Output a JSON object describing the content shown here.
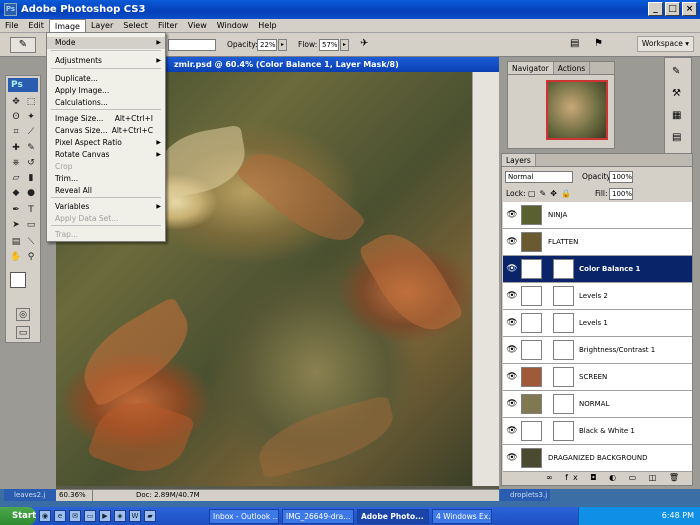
{
  "app": {
    "title": "Adobe Photoshop CS3",
    "icon_label": "Ps"
  },
  "menubar": [
    "File",
    "Edit",
    "Image",
    "Layer",
    "Select",
    "Filter",
    "View",
    "Window",
    "Help"
  ],
  "options": {
    "opacity_label": "Opacity:",
    "opacity_value": "22%",
    "flow_label": "Flow:",
    "flow_value": "57%",
    "workspace_label": "Workspace ▾"
  },
  "image_menu": {
    "items": [
      {
        "label": "Mode",
        "submenu": true,
        "disabled": false,
        "shortcut": ""
      },
      {
        "label": "Adjustments",
        "submenu": true,
        "disabled": false,
        "shortcut": ""
      },
      {
        "label": "Duplicate...",
        "submenu": false,
        "disabled": false,
        "shortcut": ""
      },
      {
        "label": "Apply Image...",
        "submenu": false,
        "disabled": false,
        "shortcut": ""
      },
      {
        "label": "Calculations...",
        "submenu": false,
        "disabled": false,
        "shortcut": ""
      },
      {
        "label": "Image Size...",
        "submenu": false,
        "disabled": false,
        "shortcut": "Alt+Ctrl+I"
      },
      {
        "label": "Canvas Size...",
        "submenu": false,
        "disabled": false,
        "shortcut": "Alt+Ctrl+C"
      },
      {
        "label": "Pixel Aspect Ratio",
        "submenu": true,
        "disabled": false,
        "shortcut": ""
      },
      {
        "label": "Rotate Canvas",
        "submenu": true,
        "disabled": false,
        "shortcut": ""
      },
      {
        "label": "Crop",
        "submenu": false,
        "disabled": true,
        "shortcut": ""
      },
      {
        "label": "Trim...",
        "submenu": false,
        "disabled": false,
        "shortcut": ""
      },
      {
        "label": "Reveal All",
        "submenu": false,
        "disabled": false,
        "shortcut": ""
      },
      {
        "label": "Variables",
        "submenu": true,
        "disabled": false,
        "shortcut": ""
      },
      {
        "label": "Apply Data Set...",
        "submenu": false,
        "disabled": true,
        "shortcut": ""
      },
      {
        "label": "Trap...",
        "submenu": false,
        "disabled": true,
        "shortcut": ""
      }
    ]
  },
  "document": {
    "title": "zmir.psd @ 60.4% (Color Balance 1, Layer Mask/8)",
    "zoom": "60.36%",
    "doc_info": "Doc: 2.89M/40.7M"
  },
  "minimized": {
    "left": "leaves2.j",
    "right": "droplets3.j"
  },
  "navigator": {
    "tabs": [
      "Navigator",
      "Actions"
    ]
  },
  "layers": {
    "tab": "Layers",
    "blend_mode": "Normal",
    "opacity_label": "Opacity:",
    "opacity_value": "100%",
    "lock_label": "Lock:",
    "fill_label": "Fill:",
    "fill_value": "100%",
    "rows": [
      {
        "name": "NINJA",
        "mask": false,
        "selected": false,
        "thumb": "#5a6030"
      },
      {
        "name": "FLATTEN",
        "mask": false,
        "selected": false,
        "thumb": "#6a5a30"
      },
      {
        "name": "Color Balance 1",
        "mask": true,
        "selected": true,
        "thumb": "#ffffff"
      },
      {
        "name": "Levels 2",
        "mask": true,
        "selected": false,
        "thumb": "#ffffff"
      },
      {
        "name": "Levels 1",
        "mask": true,
        "selected": false,
        "thumb": "#ffffff"
      },
      {
        "name": "Brightness/Contrast 1",
        "mask": true,
        "selected": false,
        "thumb": "#ffffff"
      },
      {
        "name": "SCREEN",
        "mask": true,
        "selected": false,
        "thumb": "#a05a3a"
      },
      {
        "name": "NORMAL",
        "mask": true,
        "selected": false,
        "thumb": "#807850"
      },
      {
        "name": "Black & White 1",
        "mask": true,
        "selected": false,
        "thumb": "#ffffff"
      },
      {
        "name": "DRAGANIZED BACKGROUND",
        "mask": false,
        "selected": false,
        "thumb": "#4a4a30"
      }
    ],
    "footer": "∞ fx ◘ ◐ ▭ ◫ 🗑"
  },
  "taskbar": {
    "start": "Start",
    "tasks": [
      {
        "label": "Inbox - Outlook ...",
        "active": false
      },
      {
        "label": "IMG_26649-dra...",
        "active": false
      },
      {
        "label": "Adobe Photo...",
        "active": true
      },
      {
        "label": "4 Windows Ex...",
        "active": false
      }
    ],
    "clock": "6:48 PM"
  }
}
